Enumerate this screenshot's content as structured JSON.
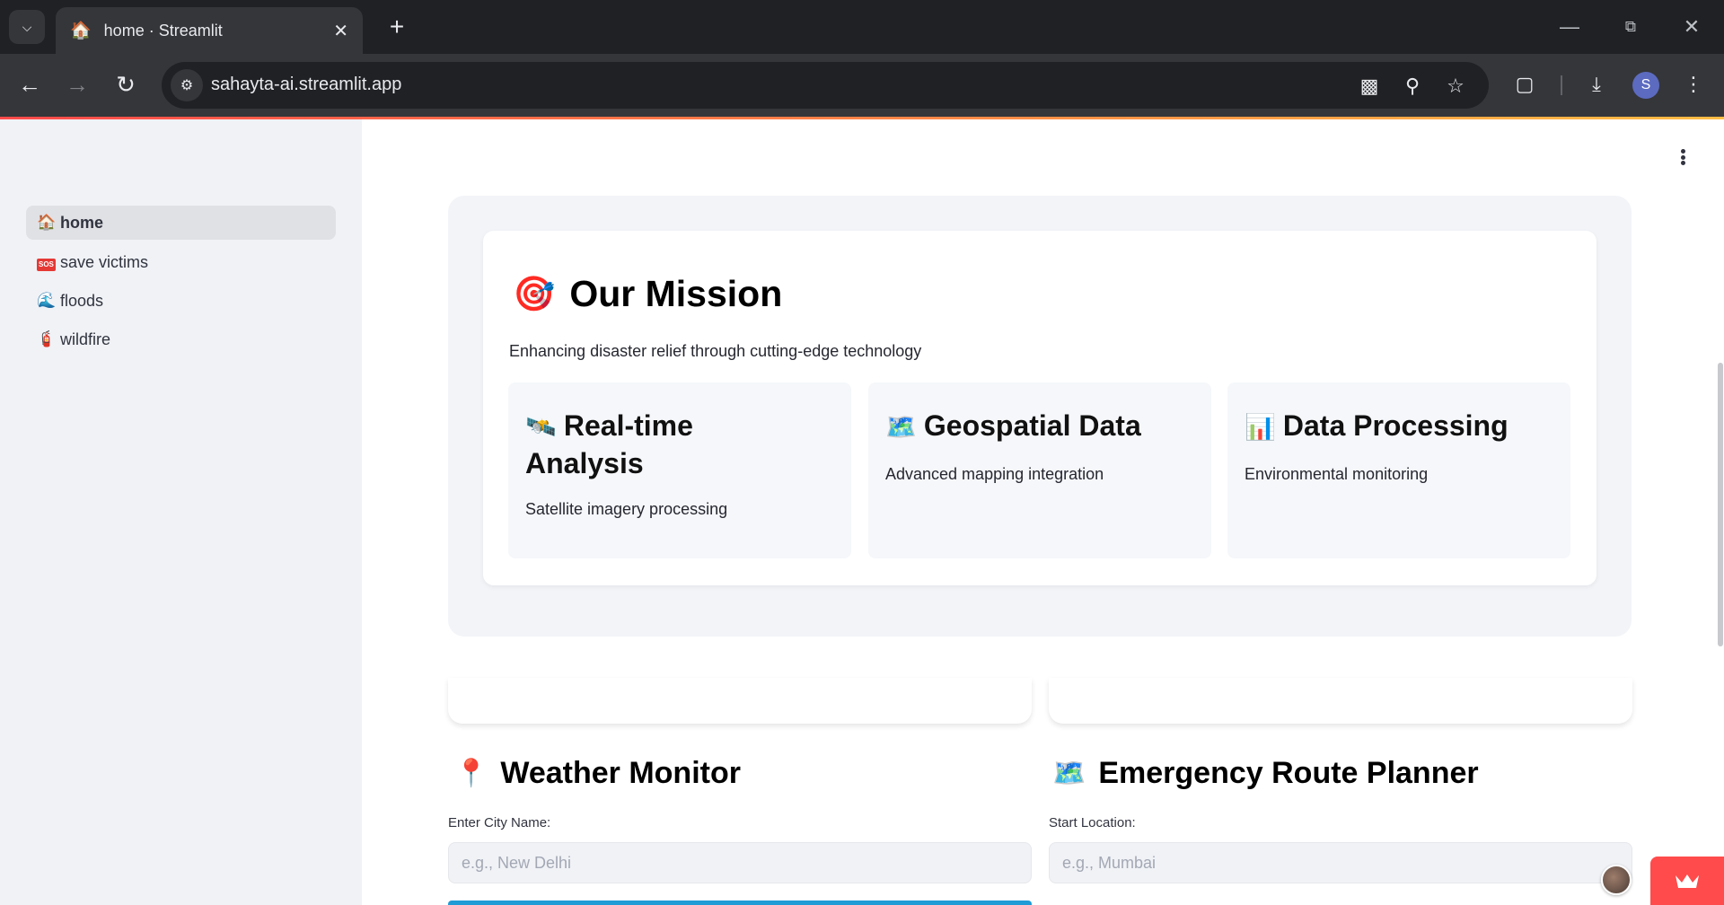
{
  "browser": {
    "tab_title": "home · Streamlit",
    "tab_favicon": "🏠",
    "url": "sahayta-ai.streamlit.app",
    "avatar_letter": "S"
  },
  "sidebar": {
    "items": [
      {
        "emoji": "🏠",
        "label": "home",
        "active": true
      },
      {
        "emoji": "SOS",
        "label": "save victims",
        "active": false
      },
      {
        "emoji": "🌊",
        "label": "floods",
        "active": false
      },
      {
        "emoji": "🧯",
        "label": "wildfire",
        "active": false
      }
    ]
  },
  "mission": {
    "emoji": "🎯",
    "title": "Our Mission",
    "subtitle": "Enhancing disaster relief through cutting-edge technology",
    "features": [
      {
        "emoji": "🛰️",
        "title_line1": "Real-time",
        "title_line2": "Analysis",
        "desc": "Satellite imagery processing"
      },
      {
        "emoji": "🗺️",
        "title": "Geospatial Data",
        "desc": "Advanced mapping integration"
      },
      {
        "emoji": "📊",
        "title": "Data Processing",
        "desc": "Environmental monitoring"
      }
    ]
  },
  "weather": {
    "emoji": "📍",
    "title": "Weather Monitor",
    "city_label": "Enter City Name:",
    "city_placeholder": "e.g., New Delhi",
    "city_value": ""
  },
  "route": {
    "emoji": "🗺️",
    "title": "Emergency Route Planner",
    "start_label": "Start Location:",
    "start_placeholder": "e.g., Mumbai",
    "start_value": ""
  },
  "colors": {
    "accent": "#ff4b4b",
    "sidebar_bg": "#f0f2f6",
    "button_blue": "#1f9bd6"
  }
}
